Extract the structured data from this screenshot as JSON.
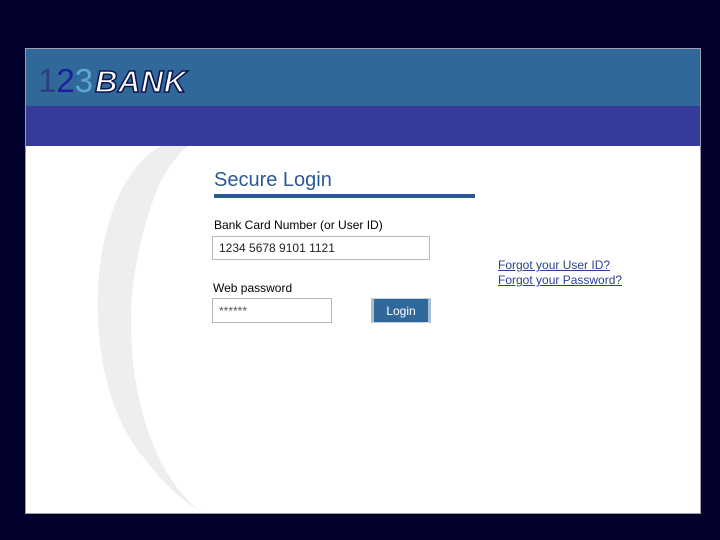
{
  "brand": {
    "logo_digit_1": "1",
    "logo_digit_2": "2",
    "logo_digit_3": "3",
    "logo_word": "BANK"
  },
  "login": {
    "title": "Secure Login",
    "card_label": "Bank Card Number (or User ID)",
    "card_value": "1234 5678 9101 1121",
    "password_label": "Web password",
    "password_value": "******",
    "login_button": "Login"
  },
  "links": {
    "forgot_user_id": "Forgot your User ID?",
    "forgot_password": "Forgot your Password?"
  },
  "colors": {
    "page_background": "#02012e",
    "header": "#31689a",
    "subbar": "#363a99",
    "title": "#2a5a92",
    "link": "#2a3f94"
  }
}
